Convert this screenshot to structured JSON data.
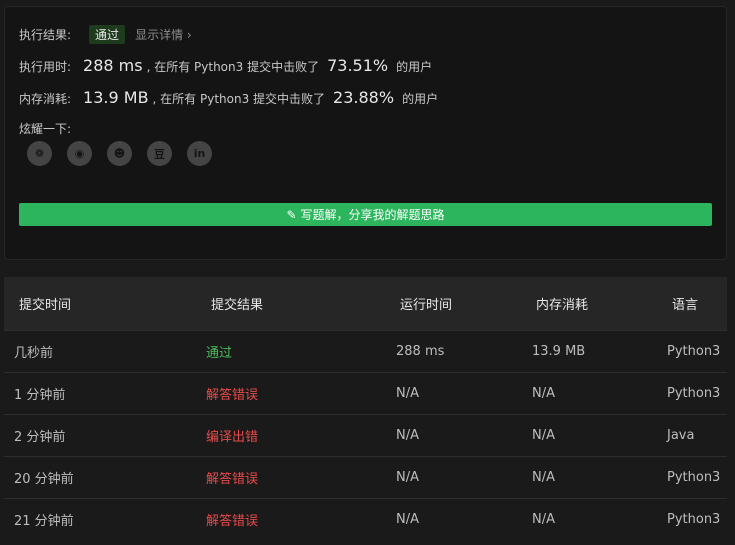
{
  "result": {
    "label": "执行结果:",
    "status": "通过",
    "details_link": "显示详情 ›"
  },
  "runtime": {
    "label": "执行用时:",
    "value": "288 ms",
    "prefix": ", 在所有 Python3 提交中击败了",
    "percent": "73.51%",
    "suffix": "的用户"
  },
  "memory": {
    "label": "内存消耗:",
    "value": "13.9 MB",
    "prefix": ", 在所有 Python3 提交中击败了",
    "percent": "23.88%",
    "suffix": "的用户"
  },
  "share": {
    "label": "炫耀一下:",
    "buttons": [
      {
        "icon": "wechat-icon",
        "glyph": "❁"
      },
      {
        "icon": "weibo-icon",
        "glyph": "◉"
      },
      {
        "icon": "qq-icon",
        "glyph": "☻"
      },
      {
        "icon": "douban-icon",
        "glyph": "豆"
      },
      {
        "icon": "linkedin-icon",
        "glyph": "in"
      }
    ]
  },
  "cta_label": "写题解，分享我的解题思路",
  "table": {
    "headers": [
      "提交时间",
      "提交结果",
      "运行时间",
      "内存消耗",
      "语言"
    ],
    "rows": [
      {
        "time": "几秒前",
        "result": "通过",
        "result_type": "ok",
        "runtime": "288 ms",
        "memory": "13.9 MB",
        "lang": "Python3"
      },
      {
        "time": "1 分钟前",
        "result": "解答错误",
        "result_type": "err",
        "runtime": "N/A",
        "memory": "N/A",
        "lang": "Python3"
      },
      {
        "time": "2 分钟前",
        "result": "编译出错",
        "result_type": "err",
        "runtime": "N/A",
        "memory": "N/A",
        "lang": "Java"
      },
      {
        "time": "20 分钟前",
        "result": "解答错误",
        "result_type": "err",
        "runtime": "N/A",
        "memory": "N/A",
        "lang": "Python3"
      },
      {
        "time": "21 分钟前",
        "result": "解答错误",
        "result_type": "err",
        "runtime": "N/A",
        "memory": "N/A",
        "lang": "Python3"
      }
    ]
  },
  "colors": {
    "accent": "#2cb55d",
    "ok": "#4cbc5b",
    "error": "#e54b4b"
  }
}
